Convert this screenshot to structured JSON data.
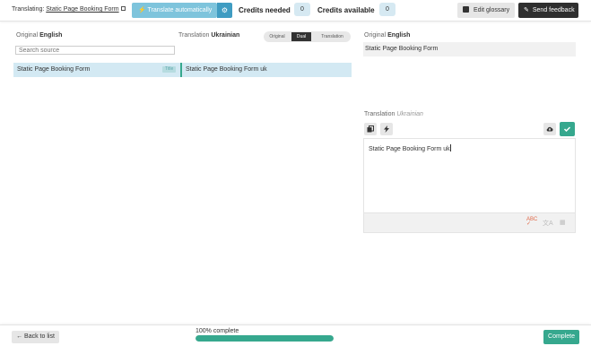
{
  "header": {
    "translating_label": "Translating:",
    "translating_link": "Static Page Booking Form",
    "auto_translate_label": "Translate automatically",
    "credits_needed_label": "Credits needed",
    "credits_needed_value": "0",
    "credits_available_label": "Credits available",
    "credits_available_value": "0",
    "edit_glossary_label": "Edit glossary",
    "send_feedback_label": "Send feedback"
  },
  "list": {
    "original_label": "Original",
    "original_lang": "English",
    "translation_label": "Translation",
    "translation_lang": "Ukrainian",
    "view_modes": [
      "Original",
      "Dual",
      "Translation"
    ],
    "selected_view_mode": "Dual",
    "search_placeholder": "Search source",
    "rows": [
      {
        "source": "Static Page Booking Form",
        "tag": "Title",
        "translation": "Static Page Booking Form uk"
      }
    ]
  },
  "editor": {
    "original_label": "Original",
    "original_lang": "English",
    "source_text": "Static Page Booking Form",
    "translation_label": "Translation",
    "translation_lang": "Ukrainian",
    "translation_text": "Static Page Booking Form uk"
  },
  "footer": {
    "back_label": "← Back to list",
    "progress_label": "100% complete",
    "progress_percent": 100,
    "complete_label": "Complete"
  },
  "colors": {
    "accent_green": "#36a88e",
    "auto_button_blue": "#7ec4dc",
    "selected_row_blue": "#d3e9f3"
  }
}
